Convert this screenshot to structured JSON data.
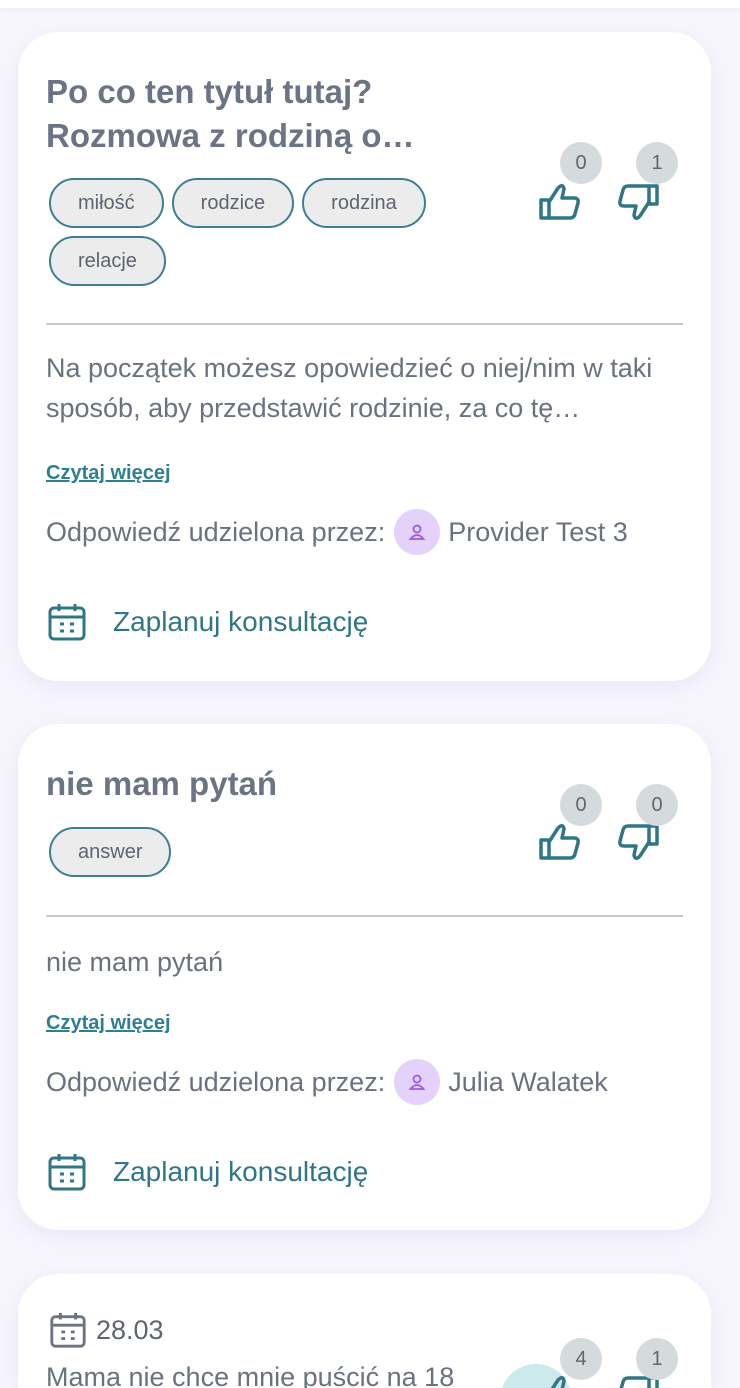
{
  "cards": [
    {
      "title": "Po co ten tytuł tutaj? Rozmowa z rodziną o…",
      "tags": [
        "miłość",
        "rodzice",
        "rodzina",
        "relacje"
      ],
      "likes": "0",
      "dislikes": "1",
      "excerpt": "Na początek możesz opowiedzieć o niej/nim w taki sposób, aby przedstawić rodzinie, za co tę…",
      "read_more": "Czytaj więcej",
      "answered_by_label": "Odpowiedź udzielona przez:",
      "provider": "Provider Test 3",
      "schedule_label": "Zaplanuj konsultację"
    },
    {
      "title": "nie mam pytań",
      "tags": [
        "answer"
      ],
      "likes": "0",
      "dislikes": "0",
      "excerpt": "nie mam pytań",
      "read_more": "Czytaj więcej",
      "answered_by_label": "Odpowiedź udzielona przez:",
      "provider": "Julia Walatek",
      "schedule_label": "Zaplanuj konsultację"
    },
    {
      "date": "28.03",
      "excerpt": "Mama nie chce mnie puścić na 18",
      "likes": "4",
      "dislikes": "1"
    }
  ],
  "icons": {
    "like": "thumbs-up-icon",
    "dislike": "thumbs-down-icon",
    "calendar": "calendar-icon",
    "avatar": "user-icon"
  },
  "colors": {
    "accent": "#2f7687",
    "tag_border": "#3e7e92",
    "avatar_bg": "#e4d2fb",
    "avatar_icon": "#9b59f0",
    "background": "#f7f6fc"
  }
}
